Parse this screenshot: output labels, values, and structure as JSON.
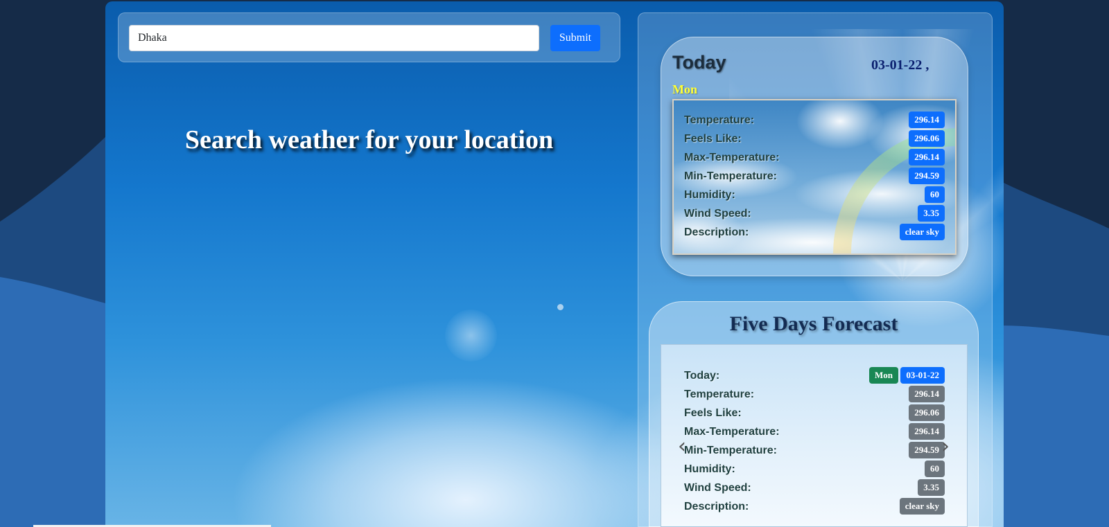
{
  "search": {
    "value": "Dhaka",
    "submit_label": "Submit"
  },
  "headline": "Search weather for your location",
  "today": {
    "title": "Today",
    "date": "03-01-22 ,",
    "day": "Mon",
    "rows": [
      {
        "label": "Temperature:",
        "value": "296.14"
      },
      {
        "label": "Feels Like:",
        "value": "296.06"
      },
      {
        "label": "Max-Temperature:",
        "value": "296.14"
      },
      {
        "label": "Min-Temperature:",
        "value": "294.59"
      },
      {
        "label": "Humidity:",
        "value": "60"
      },
      {
        "label": "Wind Speed:",
        "value": "3.35"
      },
      {
        "label": "Description:",
        "value": "clear sky"
      }
    ]
  },
  "forecast": {
    "title": "Five Days Forecast",
    "today_label": "Today:",
    "day_badge": "Mon",
    "date_badge": "03-01-22",
    "rows": [
      {
        "label": "Temperature:",
        "value": "296.14"
      },
      {
        "label": "Feels Like:",
        "value": "296.06"
      },
      {
        "label": "Max-Temperature:",
        "value": "296.14"
      },
      {
        "label": "Min-Temperature:",
        "value": "294.59"
      },
      {
        "label": "Humidity:",
        "value": "60"
      },
      {
        "label": "Wind Speed:",
        "value": "3.35"
      },
      {
        "label": "Description:",
        "value": "clear sky"
      }
    ],
    "prev_icon": "chevron-left-icon",
    "next_icon": "chevron-right-icon"
  },
  "colors": {
    "primary": "#0d6efd",
    "secondary": "#6c757d",
    "success": "#198754",
    "day_highlight": "#ffff33"
  }
}
